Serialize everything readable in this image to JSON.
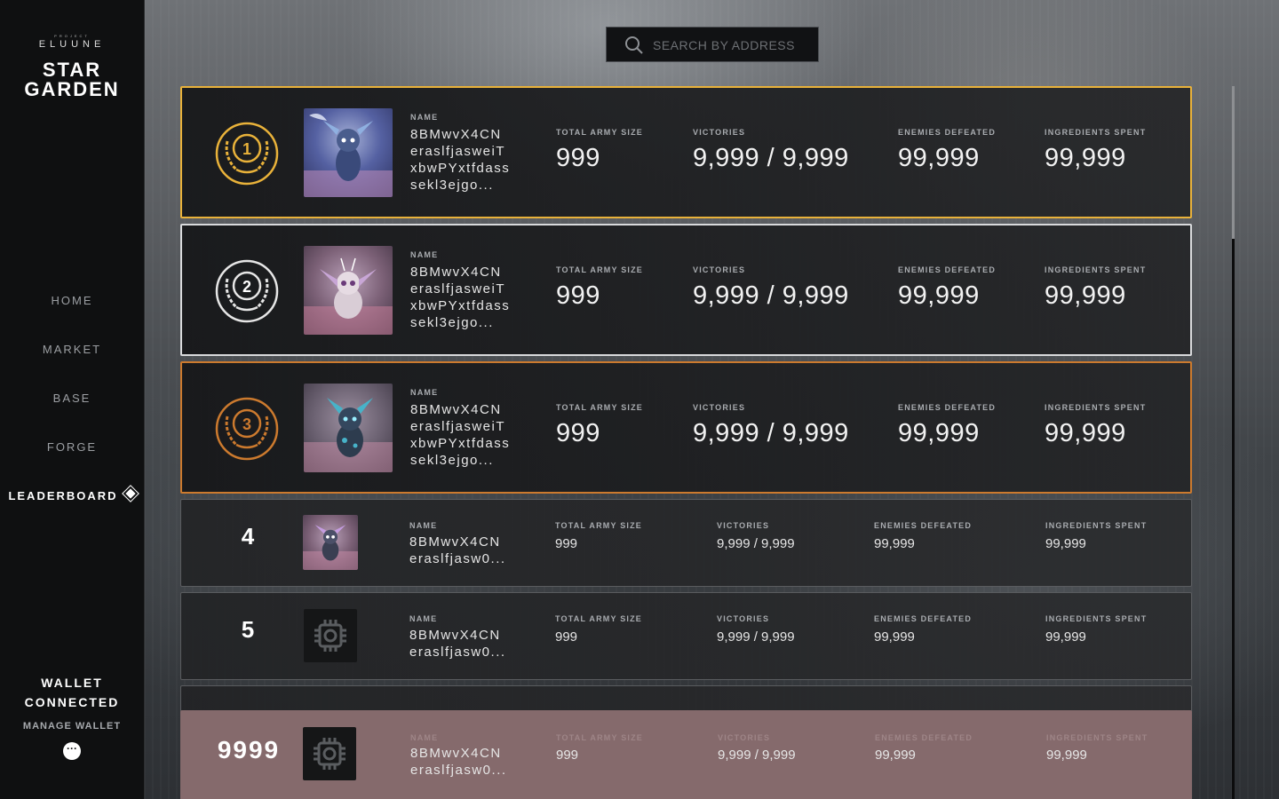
{
  "sidebar": {
    "logo": {
      "superscript": "PROJECT",
      "brand": "ELUUNE",
      "title_line1": "STAR",
      "title_line2": "GARDEN"
    },
    "nav": [
      {
        "label": "HOME"
      },
      {
        "label": "MARKET"
      },
      {
        "label": "BASE"
      },
      {
        "label": "FORGE"
      },
      {
        "label": "LEADERBOARD",
        "active": true
      }
    ],
    "wallet": {
      "status_line1": "WALLET",
      "status_line2": "CONNECTED",
      "manage": "MANAGE WALLET",
      "more_icon": "···"
    }
  },
  "search": {
    "placeholder": "SEARCH BY ADDRESS",
    "value": ""
  },
  "labels": {
    "name": "NAME",
    "army": "TOTAL ARMY SIZE",
    "victories": "VICTORIES",
    "enemies": "ENEMIES DEFEATED",
    "ingredients": "INGREDIENTS SPENT"
  },
  "colors": {
    "gold": "#e9b23a",
    "silver": "#d9dadc",
    "bronze": "#cc7a2e",
    "pinned_bg": "#856a6c"
  },
  "leaderboard": [
    {
      "rank": "1",
      "tier": "gold",
      "avatar": "creature-blue",
      "name_lines": [
        "8BMwvX4CN",
        "eraslfjasweiT",
        "xbwPYxtfdass",
        "sekl3ejgo..."
      ],
      "army": "999",
      "victories": "9,999 / 9,999",
      "enemies": "99,999",
      "ingredients": "99,999"
    },
    {
      "rank": "2",
      "tier": "silver",
      "avatar": "creature-pink",
      "name_lines": [
        "8BMwvX4CN",
        "eraslfjasweiT",
        "xbwPYxtfdass",
        "sekl3ejgo..."
      ],
      "army": "999",
      "victories": "9,999 / 9,999",
      "enemies": "99,999",
      "ingredients": "99,999"
    },
    {
      "rank": "3",
      "tier": "bronze",
      "avatar": "creature-teal",
      "name_lines": [
        "8BMwvX4CN",
        "eraslfjasweiT",
        "xbwPYxtfdass",
        "sekl3ejgo..."
      ],
      "army": "999",
      "victories": "9,999 / 9,999",
      "enemies": "99,999",
      "ingredients": "99,999"
    },
    {
      "rank": "4",
      "tier": "none",
      "avatar": "creature-small",
      "name_lines": [
        "8BMwvX4CN",
        "eraslfjasw0..."
      ],
      "army": "999",
      "victories": "9,999 / 9,999",
      "enemies": "99,999",
      "ingredients": "99,999"
    },
    {
      "rank": "5",
      "tier": "none",
      "avatar": "placeholder-chip-icon",
      "name_lines": [
        "8BMwvX4CN",
        "eraslfjasw0..."
      ],
      "army": "999",
      "victories": "9,999 / 9,999",
      "enemies": "99,999",
      "ingredients": "99,999"
    }
  ],
  "current_user": {
    "rank": "9999",
    "avatar": "placeholder-chip-icon",
    "name_lines": [
      "8BMwvX4CN",
      "eraslfjasw0..."
    ],
    "army": "999",
    "victories": "9,999 / 9,999",
    "enemies": "99,999",
    "ingredients": "99,999"
  }
}
